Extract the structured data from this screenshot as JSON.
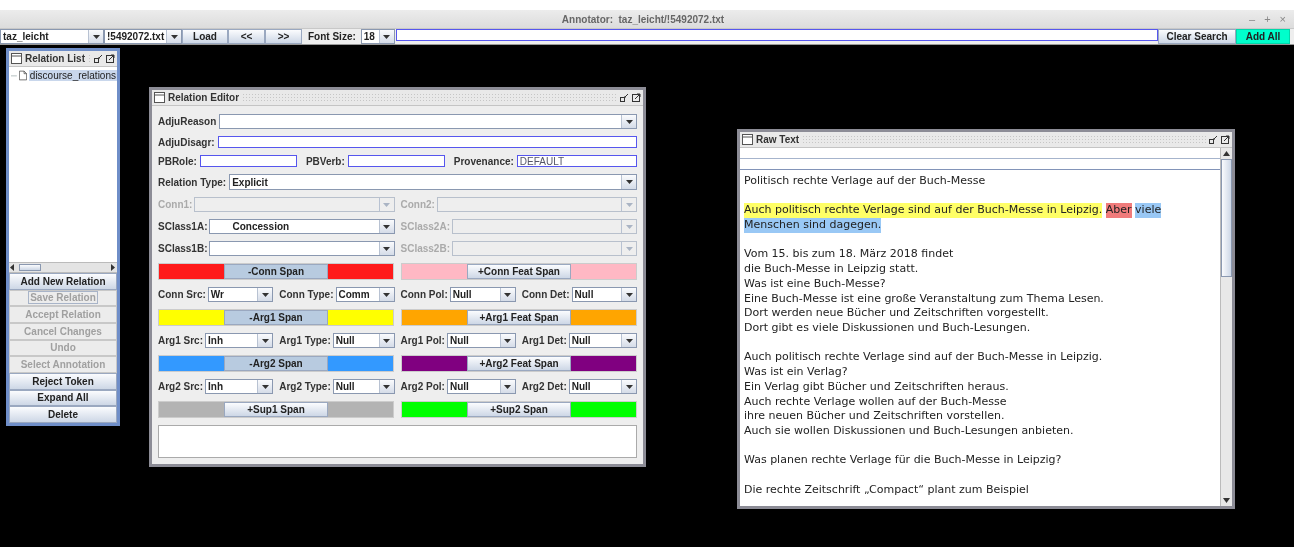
{
  "window": {
    "title": "Annotator:  taz_leicht/!5492072.txt",
    "controls": [
      "–",
      "+",
      "×"
    ]
  },
  "toolbar": {
    "corpus": "taz_leicht",
    "file": "!5492072.txt",
    "load": "Load",
    "prev": "<<",
    "next": ">>",
    "font_size_label": "Font Size:",
    "font_size": "18",
    "clear_search": "Clear Search",
    "add_all": "Add All"
  },
  "relation_list": {
    "title": "Relation List",
    "items": [
      {
        "label": "discourse_relations",
        "selected": true
      }
    ],
    "buttons": [
      {
        "label": "Add New Relation",
        "disabled": false,
        "focused": false
      },
      {
        "label": "Save Relation",
        "disabled": true,
        "focused": true
      },
      {
        "label": "Accept Relation",
        "disabled": true,
        "focused": false
      },
      {
        "label": "Cancel Changes",
        "disabled": true,
        "focused": false
      },
      {
        "label": "Undo",
        "disabled": true,
        "focused": false
      },
      {
        "label": "Select Annotation",
        "disabled": true,
        "focused": false
      },
      {
        "label": "Reject Token",
        "disabled": false,
        "focused": false
      },
      {
        "label": "Expand All",
        "disabled": false,
        "focused": false
      },
      {
        "label": "Delete",
        "disabled": false,
        "focused": false
      }
    ]
  },
  "relation_editor": {
    "title": "Relation Editor",
    "adju_reason": {
      "label": "AdjuReason"
    },
    "adju_disagr": {
      "label": "AdjuDisagr:"
    },
    "pb_role": {
      "label": "PBRole:"
    },
    "pb_verb": {
      "label": "PBVerb:"
    },
    "provenance": {
      "label": "Provenance:",
      "value": "DEFAULT"
    },
    "relation_type": {
      "label": "Relation Type:",
      "value": "Explicit"
    },
    "sense_rows": [
      [
        {
          "label": "Conn1:",
          "disabled": true
        },
        {
          "label": "Conn2:",
          "disabled": true
        }
      ],
      [
        {
          "label": "SClass1A:",
          "value": "Concession",
          "disabled": false
        },
        {
          "label": "SClass2A:",
          "disabled": true
        }
      ],
      [
        {
          "label": "SClass1B:",
          "disabled": false
        },
        {
          "label": "SClass2B:",
          "disabled": true
        }
      ]
    ],
    "sections": [
      {
        "spans": [
          {
            "label": "-Conn Span",
            "color": "#ff1a1a",
            "selected": true
          },
          {
            "label": "+Conn Feat Span",
            "color": "#ffb8c4",
            "selected": false
          }
        ],
        "features": [
          {
            "label": "Conn Src:",
            "value": "Wr"
          },
          {
            "label": "Conn Type:",
            "value": "Comm"
          },
          {
            "label": "Conn Pol:",
            "value": "Null"
          },
          {
            "label": "Conn Det:",
            "value": "Null"
          }
        ]
      },
      {
        "spans": [
          {
            "label": "-Arg1 Span",
            "color": "#ffff00",
            "selected": true
          },
          {
            "label": "+Arg1 Feat Span",
            "color": "#ffa500",
            "selected": false
          }
        ],
        "features": [
          {
            "label": "Arg1 Src:",
            "value": "Inh"
          },
          {
            "label": "Arg1 Type:",
            "value": "Null"
          },
          {
            "label": "Arg1 Pol:",
            "value": "Null"
          },
          {
            "label": "Arg1 Det:",
            "value": "Null"
          }
        ]
      },
      {
        "spans": [
          {
            "label": "-Arg2 Span",
            "color": "#3399ff",
            "selected": true
          },
          {
            "label": "+Arg2 Feat Span",
            "color": "#800080",
            "selected": false
          }
        ],
        "features": [
          {
            "label": "Arg2 Src:",
            "value": "Inh"
          },
          {
            "label": "Arg2 Type:",
            "value": "Null"
          },
          {
            "label": "Arg2 Pol:",
            "value": "Null"
          },
          {
            "label": "Arg2 Det:",
            "value": "Null"
          }
        ]
      },
      {
        "spans": [
          {
            "label": "+Sup1 Span",
            "color": "#b3b3b3",
            "selected": false
          },
          {
            "label": "+Sup2 Span",
            "color": "#00ff00",
            "selected": false
          }
        ]
      }
    ]
  },
  "raw_text": {
    "title": "Raw Text",
    "paragraphs": [
      {
        "kind": "plain",
        "lines": [
          "Politisch rechte Verlage auf der Buch-Messe"
        ]
      },
      {
        "kind": "annotated",
        "segments": [
          {
            "text": "Auch politisch rechte Verlage sind auf der Buch-Messe in Leipzig.",
            "color": "#ffff66"
          },
          {
            "text": "Aber",
            "color": "#f07b7b"
          },
          {
            "text": "viele",
            "color": "#99c8f5"
          },
          {
            "text": "Menschen sind dagegen.",
            "color": "#99c8f5"
          }
        ]
      },
      {
        "kind": "plain",
        "lines": [
          "Vom 15. bis zum 18. März 2018 findet",
          "die Buch-Messe in Leipzig statt.",
          "Was ist eine Buch-Messe?",
          "Eine Buch-Messe ist eine große Veranstaltung zum Thema Lesen.",
          "Dort werden neue Bücher und Zeitschriften vorgestellt.",
          "Dort gibt es viele Diskussionen und Buch-Lesungen."
        ]
      },
      {
        "kind": "plain",
        "lines": [
          "Auch politisch rechte Verlage sind auf der Buch-Messe in Leipzig.",
          "Was ist ein Verlag?",
          "Ein Verlag gibt Bücher und Zeitschriften heraus.",
          "Auch rechte Verlage wollen auf der Buch-Messe",
          "ihre neuen Bücher und Zeitschriften vorstellen.",
          "Auch sie wollen Diskussionen und Buch-Lesungen anbieten."
        ]
      },
      {
        "kind": "section",
        "lines": [
          "Was planen rechte Verlage für die Buch-Messe in Leipzig?"
        ]
      },
      {
        "kind": "plain",
        "lines": [
          "Die rechte Zeitschrift „Compact“ plant zum Beispiel"
        ]
      }
    ]
  }
}
